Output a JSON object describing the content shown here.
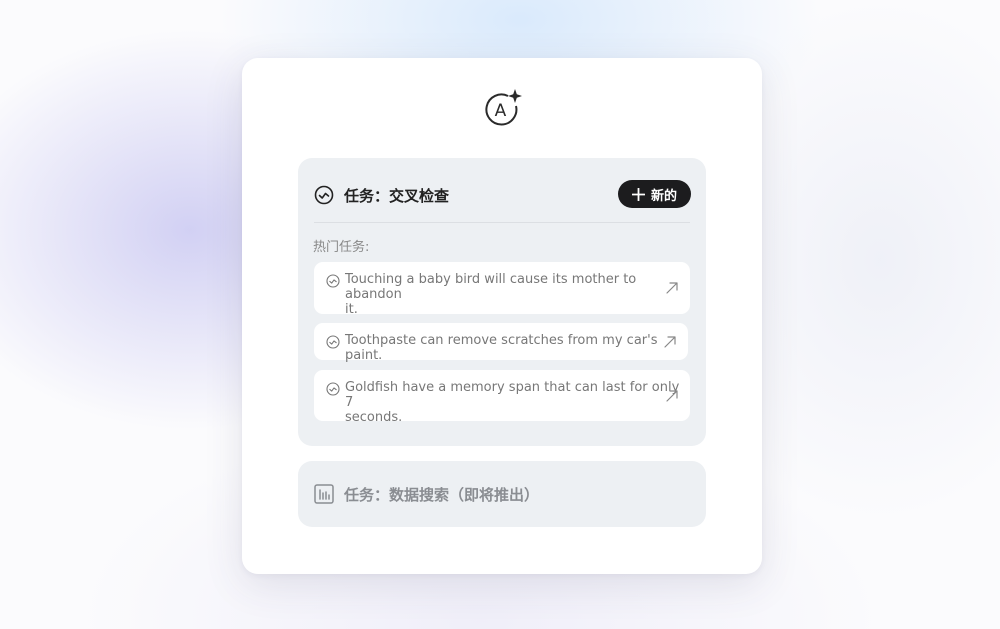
{
  "colors": {
    "card_bg": "#ffffff",
    "panel_bg": "#edf0f3",
    "button_bg": "#1c1c1e",
    "text_dark": "#222222",
    "text_muted": "#777777"
  },
  "logo": {
    "icon": "ai-sparkle-icon"
  },
  "crosscheck": {
    "icon": "check-circle-icon",
    "title": "任务：交叉检查",
    "new_button": {
      "icon": "plus-icon",
      "label": "新的"
    },
    "hot_label": "热门任务:",
    "items": [
      {
        "icon": "check-circle-icon",
        "line1": "Touching a baby bird will cause its mother to abandon",
        "line2": "it.",
        "arrow": "arrow-up-right-icon"
      },
      {
        "icon": "check-circle-icon",
        "line1": "Toothpaste can remove scratches from my car's paint.",
        "line2": "",
        "arrow": "arrow-up-right-icon"
      },
      {
        "icon": "check-circle-icon",
        "line1": "Goldfish have a memory span that can last for only 7",
        "line2": "seconds.",
        "arrow": "arrow-up-right-icon"
      }
    ]
  },
  "datasearch": {
    "icon": "bar-chart-icon",
    "title": "任务：数据搜索（即将推出）"
  }
}
